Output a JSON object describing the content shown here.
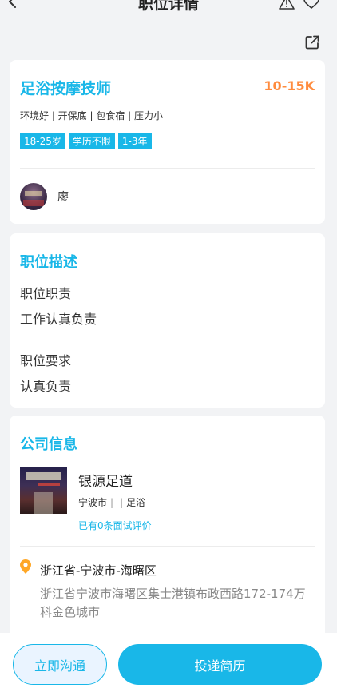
{
  "header": {
    "title": "职位详情"
  },
  "job": {
    "title": "足浴按摩技师",
    "salary": "10-15K",
    "benefits": "环境好 | 开保底 | 包食宿 | 压力小",
    "tags": [
      "18-25岁",
      "学历不限",
      "1-3年"
    ],
    "recruiter_name": "廖"
  },
  "description": {
    "section_title": "职位描述",
    "duties_heading": "职位职责",
    "duties_text": "工作认真负责",
    "requirements_heading": "职位要求",
    "requirements_text": "认真负责"
  },
  "company": {
    "section_title": "公司信息",
    "name": "银源足道",
    "city": "宁波市",
    "industry": "足浴",
    "reviews": "已有0条面试评价",
    "region": "浙江省-宁波市-海曙区",
    "address": "浙江省宁波市海曙区集士港镇布政西路172-174万科金色城市"
  },
  "actions": {
    "chat_label": "立即沟通",
    "apply_label": "投递简历"
  },
  "colors": {
    "accent": "#19b7e8",
    "salary": "#ff8b3d",
    "background": "#f2f3f5"
  }
}
